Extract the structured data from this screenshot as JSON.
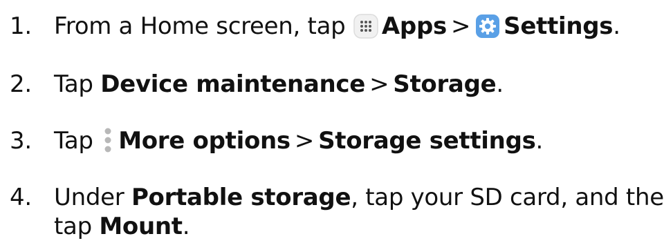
{
  "steps": [
    {
      "number": "1.",
      "text_a": "From a Home screen, tap",
      "apps_label": "Apps",
      "separator": ">",
      "settings_label": "Settings",
      "end": "."
    },
    {
      "number": "2.",
      "text_a": "Tap",
      "bold_a": "Device maintenance",
      "separator": ">",
      "bold_b": "Storage",
      "end": "."
    },
    {
      "number": "3.",
      "text_a": "Tap",
      "more_label": "More options",
      "separator": ">",
      "bold_b": "Storage settings",
      "end": "."
    },
    {
      "number": "4.",
      "text_a": "Under",
      "bold_a": "Portable storage",
      "text_b": ", tap your SD card, and then",
      "text_c": "tap",
      "bold_b": "Mount",
      "end": "."
    }
  ],
  "icons": {
    "apps": "apps-grid-icon",
    "settings": "settings-gear-icon",
    "more": "more-options-vertical-dots-icon"
  },
  "colors": {
    "text": "#111111",
    "settings_icon_bg": "#5aa0e6",
    "apps_icon_bg": "#f1f1f1",
    "more_dots": "#b8b8b8"
  }
}
